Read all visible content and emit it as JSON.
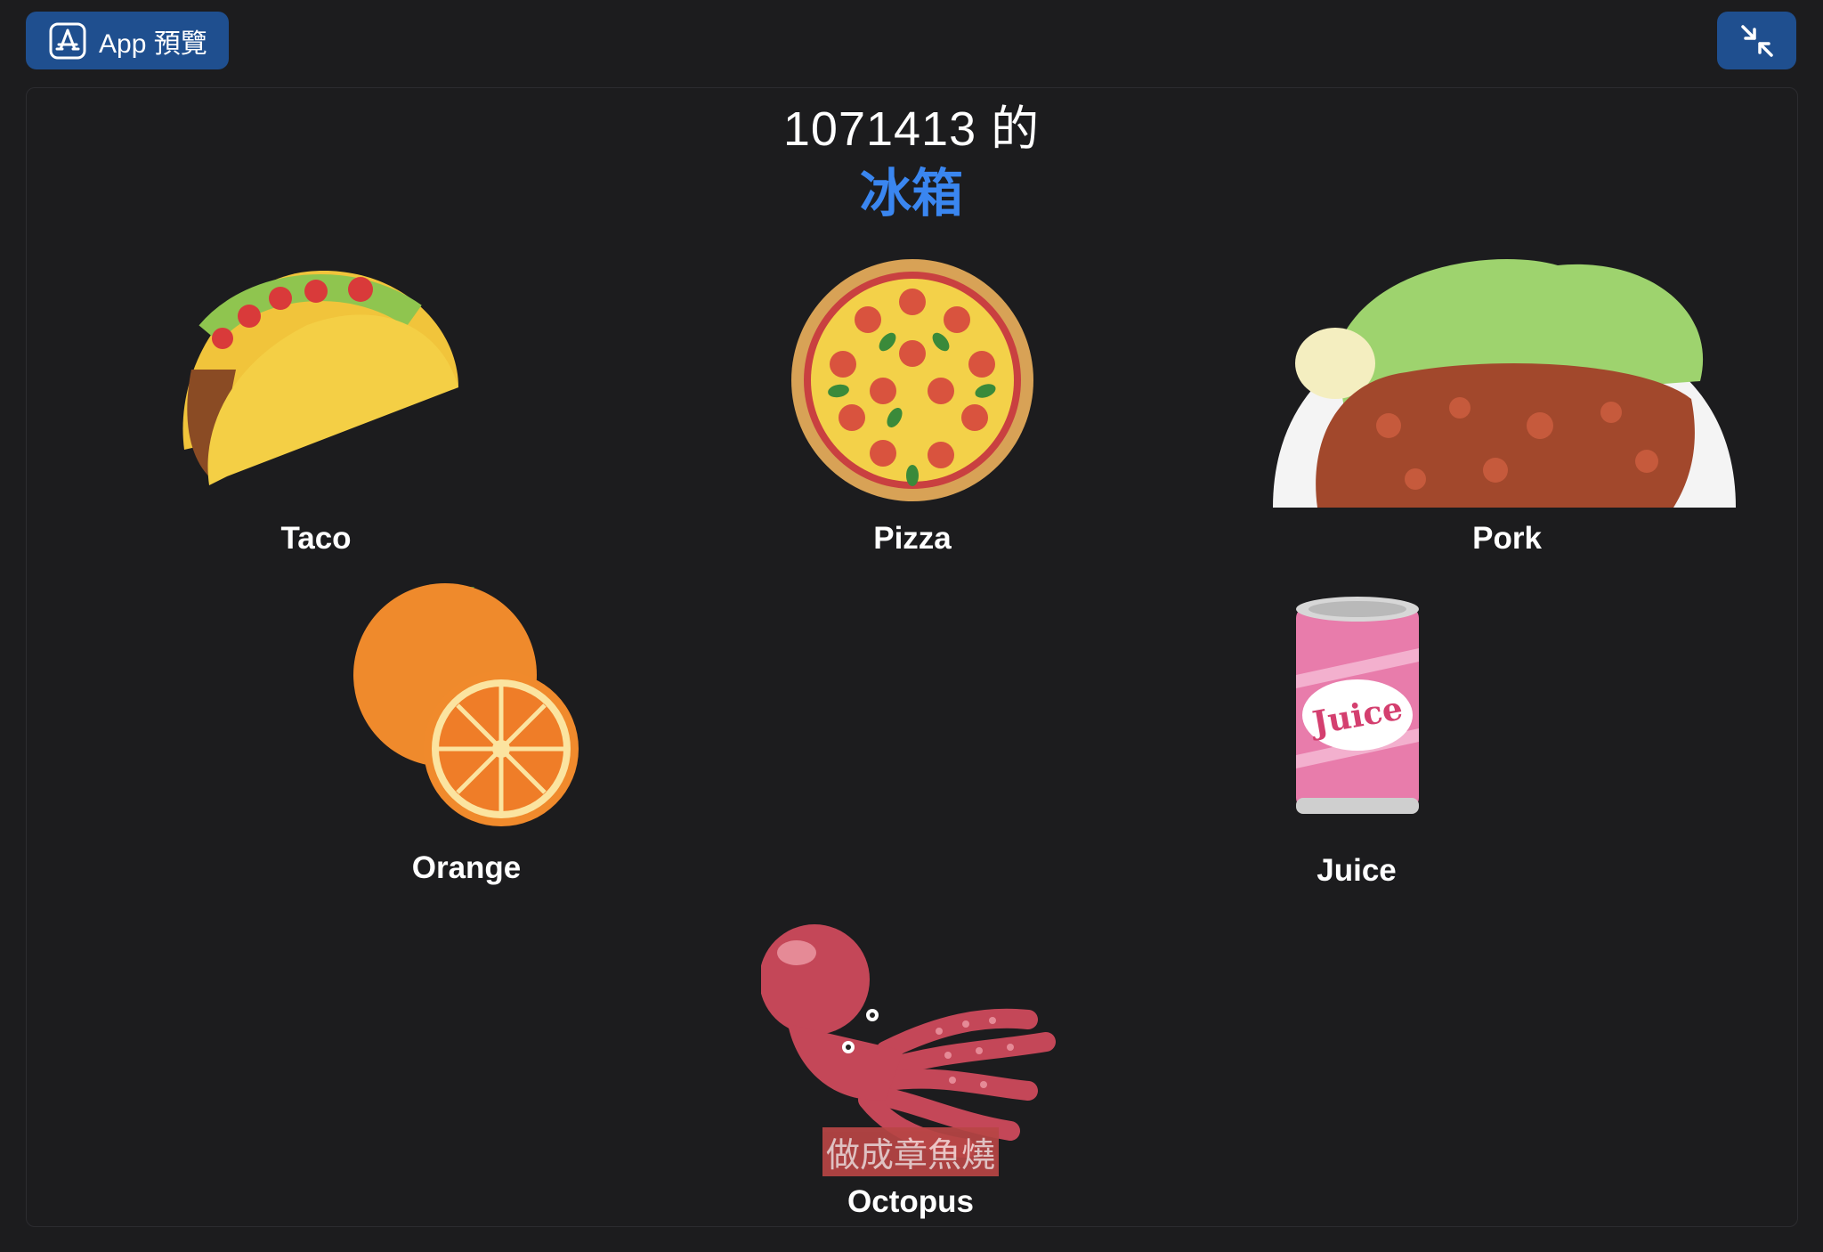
{
  "toolbar": {
    "app_preview_label": "App 預覽"
  },
  "header": {
    "owner_line": "1071413 的",
    "title": "冰箱"
  },
  "items": [
    {
      "name": "Taco"
    },
    {
      "name": "Pizza"
    },
    {
      "name": "Pork"
    },
    {
      "name": "Orange"
    },
    {
      "name": "Juice",
      "can_text": "Juice"
    },
    {
      "name": "Octopus",
      "tag": "做成章魚燒"
    }
  ]
}
